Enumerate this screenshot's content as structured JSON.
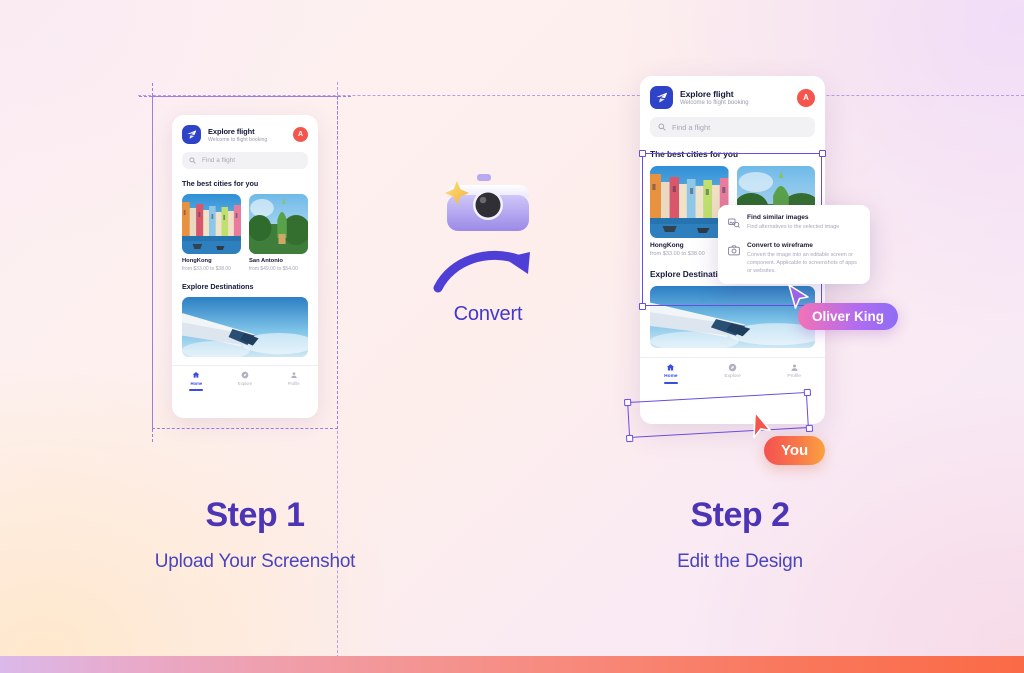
{
  "background": {
    "base_color": "#fbeef3",
    "bottom_bar_colors": [
      "#dbb9ea",
      "#f29a9f",
      "#fb6a46"
    ]
  },
  "app": {
    "logo_icon": "paper-plane-icon",
    "title": "Explore flight",
    "subtitle": "Welcome to flight booking",
    "avatar_initial": "A",
    "avatar_color": "#f4564e",
    "search": {
      "icon": "search-icon",
      "placeholder": "Find a flight"
    },
    "sections": {
      "cities_title": "The best cities for you",
      "destinations_title": "Explore Destinations"
    },
    "cities": [
      {
        "name": "HongKong",
        "price": "from $33.00 to $38.00",
        "image": "colorful-canal-houses-photo"
      },
      {
        "name": "San Antonio",
        "price": "from $49.00 to $54.00",
        "image": "green-temple-photo"
      }
    ],
    "hero_image": "airplane-wing-above-clouds-photo",
    "nav": [
      {
        "label": "Home",
        "icon": "home-icon",
        "active": true
      },
      {
        "label": "Explore",
        "icon": "compass-icon",
        "active": false
      },
      {
        "label": "Profile",
        "icon": "person-icon",
        "active": false
      }
    ]
  },
  "context_menu": {
    "items": [
      {
        "icon": "find-similar-images-icon",
        "title": "Find similar images",
        "description": "Find alternatives to the selected image"
      },
      {
        "icon": "wireframe-camera-icon",
        "title": "Convert to wireframe",
        "description": "Convert the image into an editable screen or component. Applicable to screenshots of apps or websites."
      }
    ]
  },
  "cursors": [
    {
      "name": "Oliver King",
      "color_start": "#f472b6",
      "color_end": "#8e6df5"
    },
    {
      "name": "You",
      "color_start": "#f4514f",
      "color_end": "#fba13f"
    }
  ],
  "convert": {
    "icon": "camera-sparkle-icon",
    "arrow_icon": "curved-arrow-right-icon",
    "label": "Convert"
  },
  "steps": [
    {
      "title": "Step 1",
      "subtitle": "Upload Your Screenshot"
    },
    {
      "title": "Step 2",
      "subtitle": "Edit the Design"
    }
  ],
  "selection": {
    "color": "#6b4ce0",
    "handles": 4
  }
}
